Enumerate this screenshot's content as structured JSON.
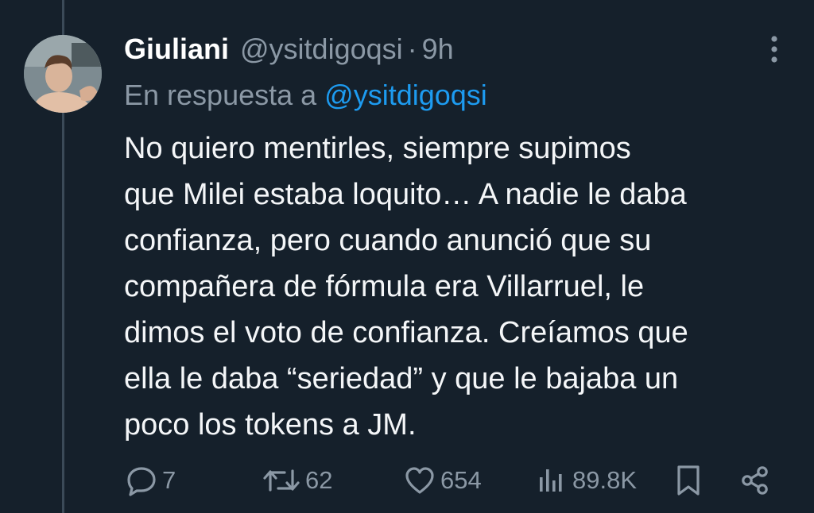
{
  "tweet": {
    "author_name": "Giuliani",
    "author_handle": "@ysitdigoqsi",
    "separator": "·",
    "time": "9h",
    "reply_prefix": "En respuesta a",
    "reply_to": "@ysitdigoqsi",
    "body_lines": [
      "No quiero mentirles, siempre supimos",
      "que Milei estaba loquito… A nadie le daba",
      "confianza, pero cuando anunció que su",
      "compañera de fórmula era Villarruel, le",
      "dimos el voto de confianza. Creíamos que",
      "ella le daba “seriedad” y que le bajaba un",
      "poco los tokens a JM."
    ]
  },
  "actions": {
    "replies": "7",
    "retweets": "62",
    "likes": "654",
    "views": "89.8K"
  },
  "icons": {
    "more": "more-vertical-icon",
    "reply": "reply-bubble-icon",
    "retweet": "retweet-icon",
    "like": "heart-icon",
    "views": "views-bar-chart-icon",
    "bookmark": "bookmark-icon",
    "share": "share-icon"
  },
  "colors": {
    "background": "#15202b",
    "text": "#f4f6f8",
    "secondary": "#8b98a5",
    "link": "#1d9bf0",
    "thread_line": "#3b4a58"
  }
}
